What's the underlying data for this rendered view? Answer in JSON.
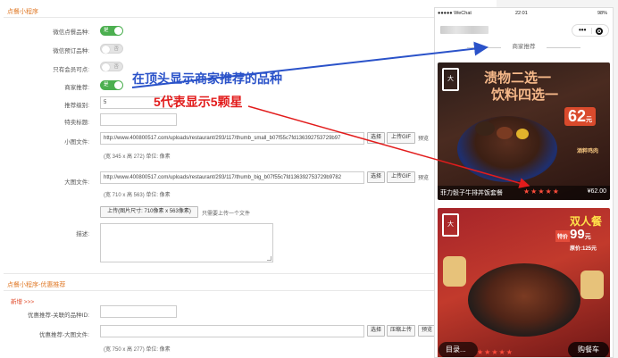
{
  "sections": {
    "mini_program": "点餐小程序",
    "mini_program_promo": "点餐小程序-优惠推荐"
  },
  "form": {
    "wechat_order": {
      "label": "微信点餐品种:",
      "state": "是"
    },
    "wechat_reserve": {
      "label": "微信预订品种:",
      "state": "否"
    },
    "members_only": {
      "label": "只有会员可点:",
      "state": "否"
    },
    "merchant_recommend": {
      "label": "商家推荐:",
      "state": "是"
    },
    "recommend_level": {
      "label": "推荐级别:",
      "value": "5"
    },
    "special_title": {
      "label": "特卖标题:",
      "value": ""
    },
    "small_image": {
      "label": "小图文件:",
      "value": "http://www.400800517.com/uploads/restaurant/293/117/thumb_small_b07f55c7fd136392753729b97",
      "hint": "(宽 345 x 高 272) 单位: 像素"
    },
    "large_image": {
      "label": "大图文件:",
      "value": "http://www.400800517.com/uploads/restaurant/293/117/thumb_big_b07f55c7fd136392753729b9782",
      "hint": "(宽 710 x 高 563) 单位: 像素"
    },
    "upload": {
      "button": "上传(图片尺寸: 710像素 x 563像素)",
      "note": "只需要上传一个文件"
    },
    "description": {
      "label": "描述:"
    },
    "buttons": {
      "choose": "选择",
      "upload_gif": "上传GIF",
      "preview": "预览",
      "compress_upload": "压缩上传"
    },
    "new_link": "新增 >>>",
    "promo_item_id": {
      "label": "优惠推荐-关联的品种ID:",
      "value": ""
    },
    "promo_large_image": {
      "label": "优惠推荐-大图文件:",
      "value": "",
      "hint": "(宽 750 x 高 277) 单位: 像素"
    }
  },
  "annotations": {
    "blue": "在顶头显示商家推荐的品种",
    "red": "5代表显示5颗星"
  },
  "phone": {
    "status": {
      "carrier": "●●●●● WeChat",
      "time": "22:01",
      "battery": "98%"
    },
    "capsule": {
      "dots": "•••"
    },
    "section_title": "商家推荐",
    "card1": {
      "logo": "大",
      "promo_line1": "溃物二选一",
      "promo_line2": "饮料四选一",
      "price_badge": "62",
      "badge_suffix": "元",
      "side_text": "酒粹鸡肉",
      "item_name": "菲力骰子牛排丼饭套餐",
      "stars": "★★★★★",
      "price": "¥62.00"
    },
    "card2": {
      "logo": "大",
      "promo": "双人餐",
      "price_label": "特价",
      "price": "99",
      "price_unit": "元",
      "orig_price": "原价:125元",
      "stars": "★★★★★",
      "menu_button": "目录...",
      "cart_button": "购餐车"
    }
  },
  "colors": {
    "toggle_on": "#4caf50",
    "accent_orange": "#e07a28",
    "annotation_blue": "#2a52c9",
    "annotation_red": "#e21c1c",
    "star_red": "#ff4d3c"
  }
}
